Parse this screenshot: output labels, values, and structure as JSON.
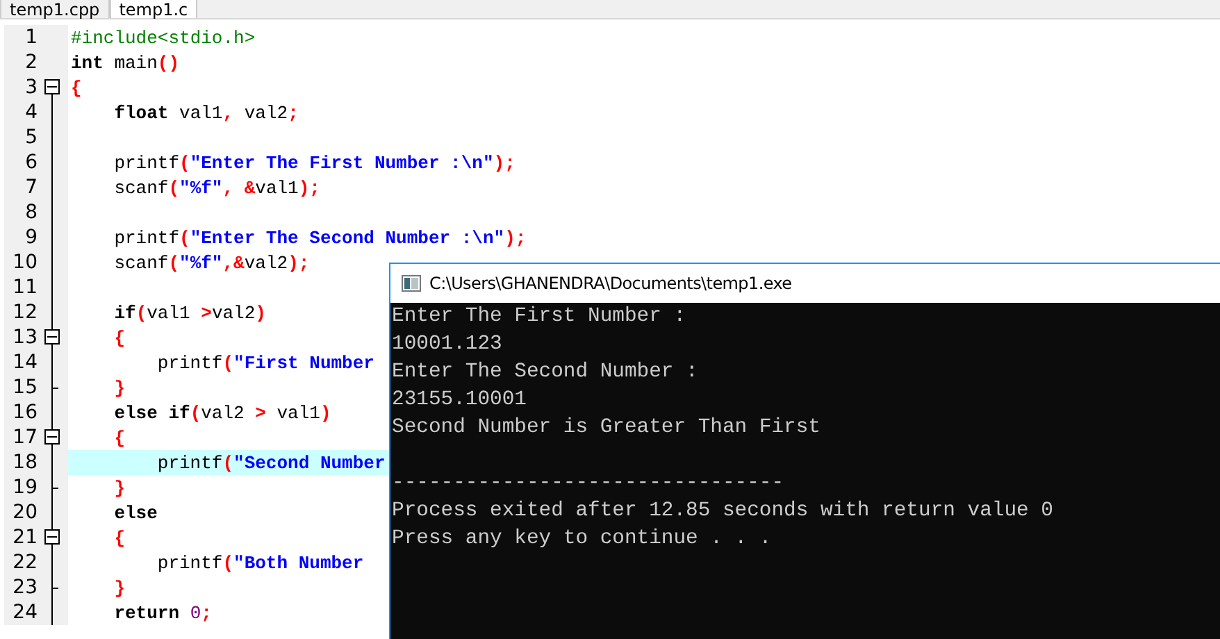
{
  "tabs": [
    {
      "label": "temp1.cpp",
      "selected": false
    },
    {
      "label": "temp1.c",
      "selected": true
    }
  ],
  "editor": {
    "lines": [
      {
        "number": "1",
        "highlighted": false,
        "tokens": [
          {
            "kind": "pre",
            "text": "#include<stdio.h>"
          }
        ]
      },
      {
        "number": "2",
        "highlighted": false,
        "tokens": [
          {
            "kind": "kw",
            "text": "int"
          },
          {
            "kind": "p",
            "text": " main"
          },
          {
            "kind": "sym",
            "text": "()"
          }
        ]
      },
      {
        "number": "3",
        "highlighted": false,
        "tokens": [
          {
            "kind": "sym",
            "text": "{"
          }
        ],
        "children": [
          {
            "number": "4",
            "highlighted": false,
            "tokens": [
              {
                "kind": "kw",
                "text": "float"
              },
              {
                "kind": "p",
                "text": " val1"
              },
              {
                "kind": "sym",
                "text": ","
              },
              {
                "kind": "p",
                "text": " val2"
              },
              {
                "kind": "sym",
                "text": ";"
              }
            ]
          },
          {
            "number": "5",
            "highlighted": false
          },
          {
            "number": "6",
            "highlighted": false,
            "tokens": [
              {
                "kind": "p",
                "text": "printf"
              },
              {
                "kind": "sym",
                "text": "("
              },
              {
                "kind": "str",
                "text": "\"Enter The First Number :\\n\""
              },
              {
                "kind": "sym",
                "text": ");"
              }
            ]
          },
          {
            "number": "7",
            "highlighted": false,
            "tokens": [
              {
                "kind": "p",
                "text": "scanf"
              },
              {
                "kind": "sym",
                "text": "("
              },
              {
                "kind": "str",
                "text": "\"%f\""
              },
              {
                "kind": "sym",
                "text": ", &"
              },
              {
                "kind": "p",
                "text": "val1"
              },
              {
                "kind": "sym",
                "text": ");"
              }
            ]
          },
          {
            "number": "8",
            "highlighted": false
          },
          {
            "number": "9",
            "highlighted": false,
            "tokens": [
              {
                "kind": "p",
                "text": "printf"
              },
              {
                "kind": "sym",
                "text": "("
              },
              {
                "kind": "str",
                "text": "\"Enter The Second Number :\\n\""
              },
              {
                "kind": "sym",
                "text": ");"
              }
            ]
          },
          {
            "number": "10",
            "highlighted": false,
            "tokens": [
              {
                "kind": "p",
                "text": "scanf"
              },
              {
                "kind": "sym",
                "text": "("
              },
              {
                "kind": "str",
                "text": "\"%f\""
              },
              {
                "kind": "sym",
                "text": ",&"
              },
              {
                "kind": "p",
                "text": "val2"
              },
              {
                "kind": "sym",
                "text": ");"
              }
            ]
          },
          {
            "number": "11",
            "highlighted": false
          },
          {
            "number": "12",
            "highlighted": false,
            "tokens": [
              {
                "kind": "kw",
                "text": "if"
              },
              {
                "kind": "sym",
                "text": "("
              },
              {
                "kind": "p",
                "text": "val1 "
              },
              {
                "kind": "sym",
                "text": ">"
              },
              {
                "kind": "p",
                "text": "val2"
              },
              {
                "kind": "sym",
                "text": ")"
              }
            ]
          },
          {
            "number": "13",
            "highlighted": false,
            "tokens": [
              {
                "kind": "sym",
                "text": "{"
              }
            ],
            "children": [
              {
                "number": "14",
                "highlighted": false,
                "tokens": [
                  {
                    "kind": "p",
                    "text": "printf"
                  },
                  {
                    "kind": "sym",
                    "text": "("
                  },
                  {
                    "kind": "str",
                    "text": "\"First Number"
                  }
                ]
              }
            ]
          },
          {
            "number": "15",
            "highlighted": false,
            "tokens": [
              {
                "kind": "sym",
                "text": "}"
              }
            ]
          },
          {
            "number": "16",
            "highlighted": false,
            "tokens": [
              {
                "kind": "kw",
                "text": "else if"
              },
              {
                "kind": "sym",
                "text": "("
              },
              {
                "kind": "p",
                "text": "val2 "
              },
              {
                "kind": "sym",
                "text": ">"
              },
              {
                "kind": "p",
                "text": " val1"
              },
              {
                "kind": "sym",
                "text": ")"
              }
            ]
          },
          {
            "number": "17",
            "highlighted": false,
            "tokens": [
              {
                "kind": "sym",
                "text": "{"
              }
            ],
            "children": [
              {
                "number": "18",
                "highlighted": true,
                "tokens": [
                  {
                    "kind": "p",
                    "text": "printf"
                  },
                  {
                    "kind": "sym",
                    "text": "("
                  },
                  {
                    "kind": "str",
                    "text": "\"Second Number"
                  }
                ]
              }
            ]
          },
          {
            "number": "19",
            "highlighted": false,
            "tokens": [
              {
                "kind": "sym",
                "text": "}"
              }
            ]
          },
          {
            "number": "20",
            "highlighted": false,
            "tokens": [
              {
                "kind": "kw",
                "text": "else"
              }
            ]
          },
          {
            "number": "21",
            "highlighted": false,
            "tokens": [
              {
                "kind": "sym",
                "text": "{"
              }
            ],
            "children": [
              {
                "number": "22",
                "highlighted": false,
                "tokens": [
                  {
                    "kind": "p",
                    "text": "printf"
                  },
                  {
                    "kind": "sym",
                    "text": "("
                  },
                  {
                    "kind": "str",
                    "text": "\"Both Number"
                  }
                ]
              }
            ]
          },
          {
            "number": "23",
            "highlighted": false,
            "tokens": [
              {
                "kind": "sym",
                "text": "}"
              }
            ]
          },
          {
            "number": "24",
            "highlighted": false,
            "tokens": [
              {
                "kind": "kw",
                "text": "return"
              },
              {
                "kind": "num",
                "text": "0",
                "space_before": true
              },
              {
                "kind": "sym",
                "text": ";"
              }
            ]
          }
        ]
      }
    ]
  },
  "console": {
    "title": "C:\\Users\\GHANENDRA\\Documents\\temp1.exe",
    "output": [
      "Enter The First Number :",
      "10001.123",
      "Enter The Second Number :",
      "23155.10001",
      "Second Number is Greater Than First"
    ],
    "separator": "--------------------------------",
    "footer": [
      "Process exited after 12.85 seconds with return value 0",
      "Press any key to continue . . ."
    ]
  }
}
